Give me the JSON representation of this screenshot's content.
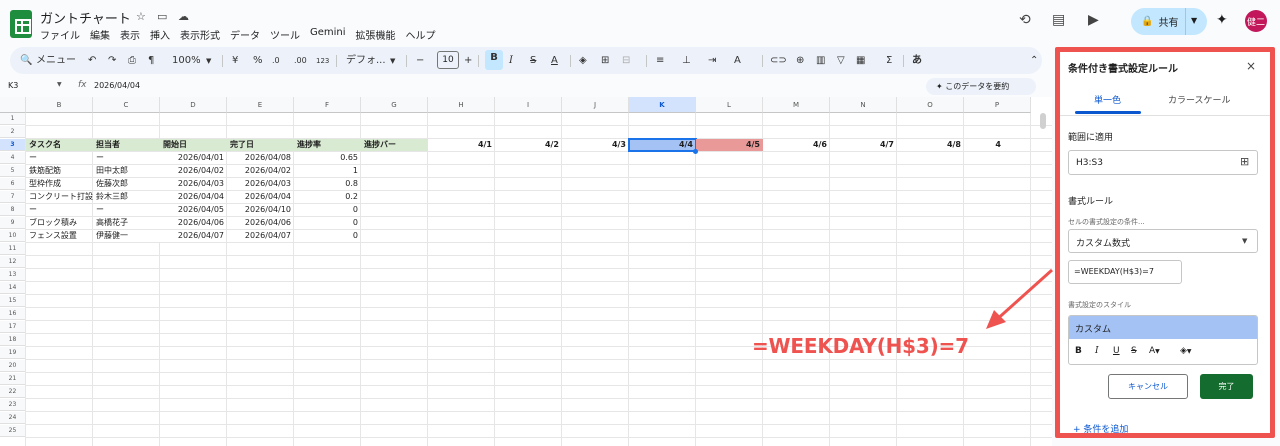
{
  "app": {
    "title": "ガントチャート",
    "menu": [
      "ファイル",
      "編集",
      "表示",
      "挿入",
      "表示形式",
      "データ",
      "ツール",
      "Gemini",
      "拡張機能",
      "ヘルプ"
    ],
    "share_label": "共有",
    "avatar_text": "健二"
  },
  "toolbar": {
    "search_label": "メニュー",
    "zoom": "100%",
    "currency": "¥",
    "percent": "%",
    "dec_less": ".0",
    "dec_more": ".00",
    "format123": "123",
    "font": "デフォ...",
    "font_size": "10",
    "input_mode": "あ"
  },
  "formula_bar": {
    "cell_ref": "K3",
    "fx": "fx",
    "value": "2026/04/04",
    "summarize_label": "このデータを要約"
  },
  "grid": {
    "columns": [
      "B",
      "C",
      "D",
      "E",
      "F",
      "G",
      "H",
      "I",
      "J",
      "K",
      "L",
      "M",
      "N",
      "O",
      "P"
    ],
    "rows": [
      "1",
      "2",
      "3",
      "4",
      "5",
      "6",
      "7",
      "8",
      "9",
      "10",
      "11",
      "12",
      "13",
      "14",
      "15",
      "16",
      "17",
      "18",
      "19",
      "20",
      "21",
      "22",
      "23",
      "24",
      "25"
    ],
    "headers": [
      "タスク名",
      "担当者",
      "開始日",
      "完了日",
      "進捗率",
      "進捗バー"
    ],
    "date_headers": [
      "4/1",
      "4/2",
      "4/3",
      "4/4",
      "4/5",
      "4/6",
      "4/7",
      "4/8",
      "4"
    ],
    "data": [
      [
        "ー",
        "ー",
        "2026/04/01",
        "2026/04/08",
        "0.65"
      ],
      [
        "鉄筋配筋",
        "田中太郎",
        "2026/04/02",
        "2026/04/02",
        "1"
      ],
      [
        "型枠作成",
        "佐藤次郎",
        "2026/04/03",
        "2026/04/03",
        "0.8"
      ],
      [
        "コンクリート打設",
        "鈴木三郎",
        "2026/04/04",
        "2026/04/04",
        "0.2"
      ],
      [
        "ー",
        "ー",
        "2026/04/05",
        "2026/04/10",
        "0"
      ],
      [
        "ブロック積み",
        "高橋花子",
        "2026/04/06",
        "2026/04/06",
        "0"
      ],
      [
        "フェンス設置",
        "伊藤健一",
        "2026/04/07",
        "2026/04/07",
        "0"
      ]
    ]
  },
  "panel": {
    "title": "条件付き書式設定ルール",
    "tab_single": "単一色",
    "tab_scale": "カラースケール",
    "range_label": "範囲に適用",
    "range_value": "H3:S3",
    "rules_label": "書式ルール",
    "condition_label": "セルの書式設定の条件...",
    "condition_value": "カスタム数式",
    "formula_value": "=WEEKDAY(H$3)=7",
    "style_label": "書式設定のスタイル",
    "style_name": "カスタム",
    "cancel": "キャンセル",
    "done": "完了",
    "add_condition": "条件を追加"
  },
  "callout": "=WEEKDAY(H$3)=7",
  "colors": {
    "header_green": "#d9ead3",
    "selected_blue": "#a4c2f4",
    "saturday_red": "#ea9999",
    "accent": "#ef5350",
    "done_green": "#146c2e"
  }
}
